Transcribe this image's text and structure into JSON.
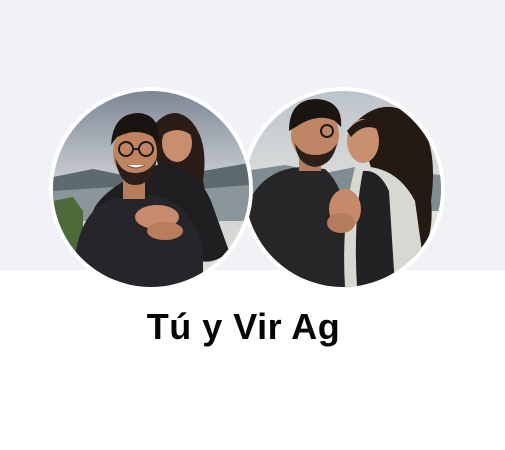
{
  "profile": {
    "title": "Tú y Vir Ag",
    "avatars": [
      {
        "icon": "couple-photo-hug"
      },
      {
        "icon": "couple-photo-embrace"
      }
    ]
  },
  "colors": {
    "cover_background": "#f0f2f5",
    "page_background": "#ffffff",
    "title_text": "#050505",
    "avatar_border": "#ffffff"
  }
}
